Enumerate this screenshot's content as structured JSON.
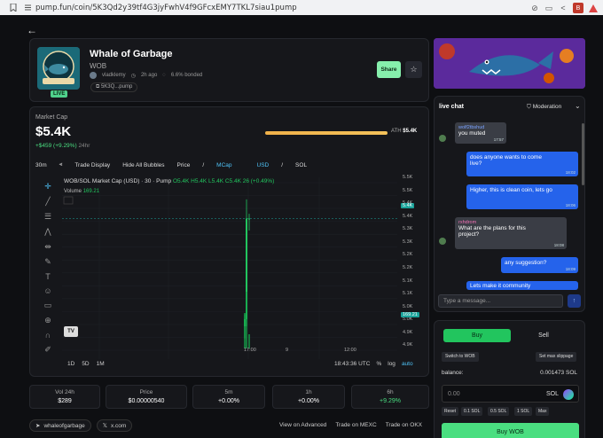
{
  "browser": {
    "url": "pump.fun/coin/5K3Qd2y39tf4G3jyFwhV4f9GFcxEMY7TKL7siau1pump"
  },
  "coin": {
    "name": "Whale of Garbage",
    "ticker": "WOB",
    "live_badge": "LIVE",
    "creator": "vladklemy",
    "age": "2h ago",
    "bonded": "6.6% bonded",
    "address_short": "5K3Q...pump",
    "logo_text": "WHALE OF GARBAGE",
    "share_label": "Share"
  },
  "market": {
    "label": "Market Cap",
    "value": "$5.4K",
    "change": "+$459 (+9.29%)",
    "period": "24hr",
    "ath_label": "ATH",
    "ath_value": "$5.4K",
    "ath_progress": 1.0
  },
  "chart_toolbar": {
    "interval": "30m",
    "trade_display": "Trade Display",
    "hide_bubbles": "Hide All Bubbles",
    "price_label": "Price",
    "mcap_label": "MCap",
    "usd_label": "USD",
    "sol_label": "SOL",
    "sep": "/"
  },
  "chart": {
    "legend": "WOB/SOL Market Cap (USD) · 30 · Pump",
    "ohlc": "O5.4K H5.4K L5.4K C5.4K 26 (+0.49%)",
    "volume_label": "Volume",
    "volume_value": "169.21",
    "time": "18:43:36 UTC",
    "pct": "%",
    "log": "log",
    "auto": "auto",
    "ranges": [
      "1D",
      "5D",
      "1M"
    ],
    "tv_logo": "TV",
    "current_badge": "5.4K",
    "volume_badge": "169.21"
  },
  "chart_data": {
    "type": "bar",
    "xlabel": "",
    "ylabel": "",
    "y_ticks": [
      "5.5K",
      "5.5K",
      "5.4K",
      "5.4K",
      "5.3K",
      "5.3K",
      "5.2K",
      "5.2K",
      "5.1K",
      "5.1K",
      "5.0K",
      "5.0K",
      "4.9K",
      "4.9K"
    ],
    "x_ticks": [
      "17:00",
      "9",
      "12:00"
    ],
    "ylim": [
      4.85,
      5.55
    ],
    "candles": [
      {
        "o": 4.95,
        "h": 5.0,
        "l": 4.9,
        "c": 4.98
      },
      {
        "o": 4.98,
        "h": 5.48,
        "l": 4.95,
        "c": 5.4
      },
      {
        "o": 5.4,
        "h": 5.42,
        "l": 5.35,
        "c": 5.4
      }
    ]
  },
  "stats": [
    {
      "k": "Vol 24h",
      "v": "$289",
      "green": false
    },
    {
      "k": "Price",
      "v": "$0.00000540",
      "green": false
    },
    {
      "k": "5m",
      "v": "+0.00%",
      "green": false
    },
    {
      "k": "1h",
      "v": "+0.00%",
      "green": false
    },
    {
      "k": "6h",
      "v": "+9.29%",
      "green": true
    }
  ],
  "footer": {
    "handle": "whaleofgarbage",
    "x_label": "x.com",
    "view_advanced": "View on Advanced",
    "trade_mexc": "Trade on MEXC",
    "trade_okx": "Trade on OKX"
  },
  "chat": {
    "title": "live chat",
    "moderation": "Moderation",
    "input_placeholder": "Type a message...",
    "messages": [
      {
        "dir": "in",
        "user": "wolf2tbshud",
        "text": "you muted",
        "time": "17:57"
      },
      {
        "dir": "out",
        "text": "does anyone wants to come live?",
        "time": "18:02"
      },
      {
        "dir": "out",
        "text": "Higher, this is clean coin, lets go",
        "time": "18:06"
      },
      {
        "dir": "in",
        "user": "rxhdrom",
        "text": "What are the plans for this project?",
        "time": "18:08"
      },
      {
        "dir": "out",
        "text": "any suggestion?",
        "time": "18:09"
      },
      {
        "dir": "out",
        "text": "Lets make it community",
        "time": ""
      }
    ]
  },
  "trade": {
    "buy": "Buy",
    "sell": "Sell",
    "switch": "Switch to WOB",
    "slippage": "Set max slippage",
    "balance_label": "balance:",
    "balance_value": "0.001473 SOL",
    "amount_placeholder": "0.00",
    "currency": "SOL",
    "chips": [
      "Reset",
      "0.1 SOL",
      "0.5 SOL",
      "1 SOL",
      "Max"
    ],
    "buy_button": "Buy WOB"
  },
  "colors": {
    "accent_green": "#4ade80",
    "chat_blue": "#2563eb",
    "ath_orange": "#f0b14a",
    "bg": "#0e0f12"
  }
}
